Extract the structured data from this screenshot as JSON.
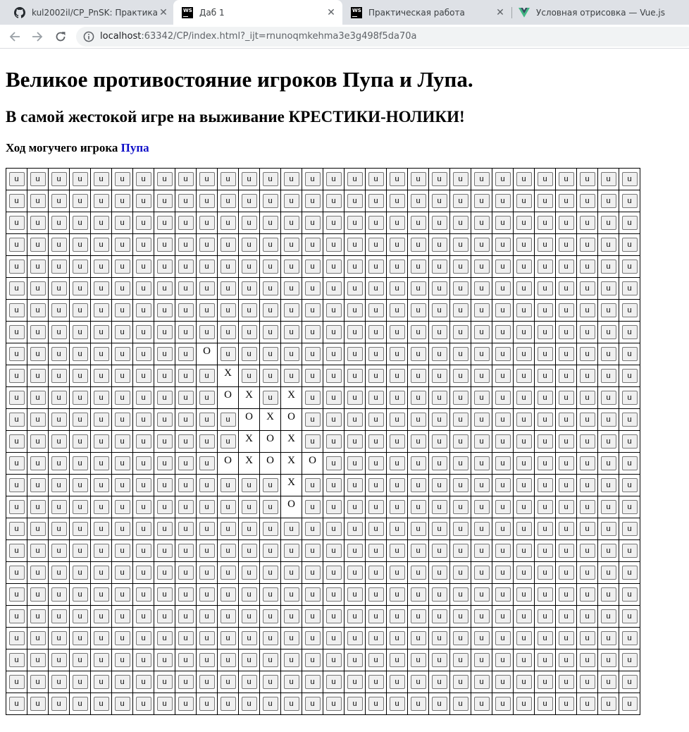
{
  "browser": {
    "tabs": [
      {
        "icon": "github-icon",
        "title": "kul2002il/CP_PnSK: Практика пр",
        "close": "✕",
        "active": false
      },
      {
        "icon": "webstorm-icon",
        "title": "Даб 1",
        "close": "✕",
        "active": true
      },
      {
        "icon": "webstorm-icon",
        "title": "Практическая работа",
        "close": "✕",
        "active": false
      },
      {
        "icon": "vue-icon",
        "title": "Условная отрисовка — Vue.js",
        "close": "",
        "active": false
      }
    ],
    "url_host": "localhost",
    "url_rest": ":63342/CP/index.html?_ijt=rnunoqmkehma3e3g498f5da70a"
  },
  "page": {
    "title": "Великое противостояние игроков Пупа и Лупа.",
    "subtitle": "В самой жестокой игре на выживание КРЕСТИКИ-НОЛИКИ!",
    "turn_label": "Ход могучего игрока",
    "current_player": "Пупа"
  },
  "board": {
    "rows": 25,
    "cols": 30,
    "empty_label": "u",
    "moves": [
      {
        "row": 8,
        "col": 9,
        "mark": "O"
      },
      {
        "row": 9,
        "col": 10,
        "mark": "X"
      },
      {
        "row": 10,
        "col": 10,
        "mark": "O"
      },
      {
        "row": 10,
        "col": 11,
        "mark": "X"
      },
      {
        "row": 10,
        "col": 13,
        "mark": "X"
      },
      {
        "row": 11,
        "col": 11,
        "mark": "O"
      },
      {
        "row": 11,
        "col": 12,
        "mark": "X"
      },
      {
        "row": 11,
        "col": 13,
        "mark": "O"
      },
      {
        "row": 12,
        "col": 11,
        "mark": "X"
      },
      {
        "row": 12,
        "col": 12,
        "mark": "O"
      },
      {
        "row": 12,
        "col": 13,
        "mark": "X"
      },
      {
        "row": 13,
        "col": 10,
        "mark": "O"
      },
      {
        "row": 13,
        "col": 11,
        "mark": "X"
      },
      {
        "row": 13,
        "col": 12,
        "mark": "O"
      },
      {
        "row": 13,
        "col": 13,
        "mark": "X"
      },
      {
        "row": 13,
        "col": 14,
        "mark": "O"
      },
      {
        "row": 14,
        "col": 13,
        "mark": "X"
      },
      {
        "row": 15,
        "col": 13,
        "mark": "O"
      }
    ]
  }
}
